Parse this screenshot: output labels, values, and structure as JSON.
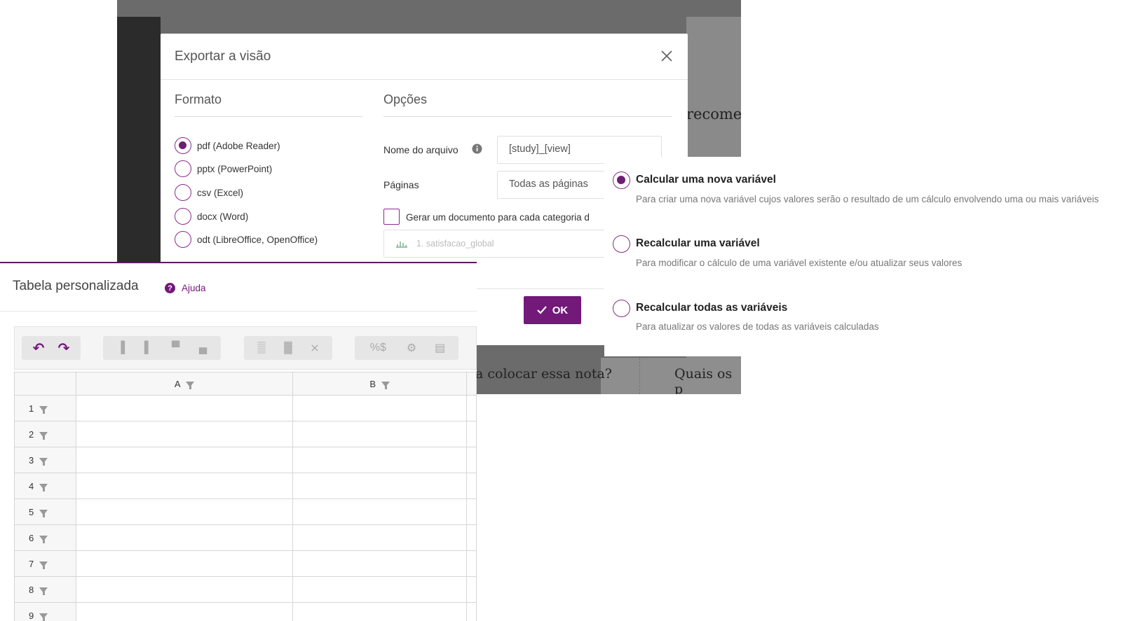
{
  "export_dialog": {
    "title": "Exportar a visão",
    "format_title": "Formato",
    "options_title": "Opções",
    "formats": [
      {
        "label": "pdf (Adobe Reader)",
        "selected": true
      },
      {
        "label": "pptx (PowerPoint)",
        "selected": false
      },
      {
        "label": "csv (Excel)",
        "selected": false
      },
      {
        "label": "docx (Word)",
        "selected": false
      },
      {
        "label": "odt (LibreOffice, OpenOffice)",
        "selected": false
      }
    ],
    "file_name_label": "Nome do arquivo",
    "file_name_value": "[study]_[view]",
    "pages_label": "Páginas",
    "pages_value": "Todas as páginas",
    "per_category_label": "Gerar um documento para cada categoria d",
    "variable_placeholder": "1. satisfacao_global",
    "ok_label": "OK",
    "background_text_1": "recome",
    "background_text_2": "a colocar essa nota?",
    "background_text_3": "Quais os p"
  },
  "calc_panel": {
    "options": [
      {
        "title": "Calcular uma nova variável",
        "desc": "Para criar uma nova variável cujos valores serão o resultado de um cálculo envolvendo uma ou mais variáveis",
        "selected": true
      },
      {
        "title": "Recalcular uma variável",
        "desc": "Para modificar o cálculo de uma variável existente e/ou atualizar seus valores",
        "selected": false
      },
      {
        "title": "Recalcular todas as variáveis",
        "desc": "Para atualizar os valores de todas as variáveis calculadas",
        "selected": false
      }
    ]
  },
  "table_panel": {
    "title": "Tabela personalizada",
    "help_label": "Ajuda",
    "columns": [
      "A",
      "B"
    ],
    "rows": [
      "1",
      "2",
      "3",
      "4",
      "5",
      "6",
      "7",
      "8",
      "9"
    ]
  },
  "colors": {
    "accent": "#72197a"
  }
}
